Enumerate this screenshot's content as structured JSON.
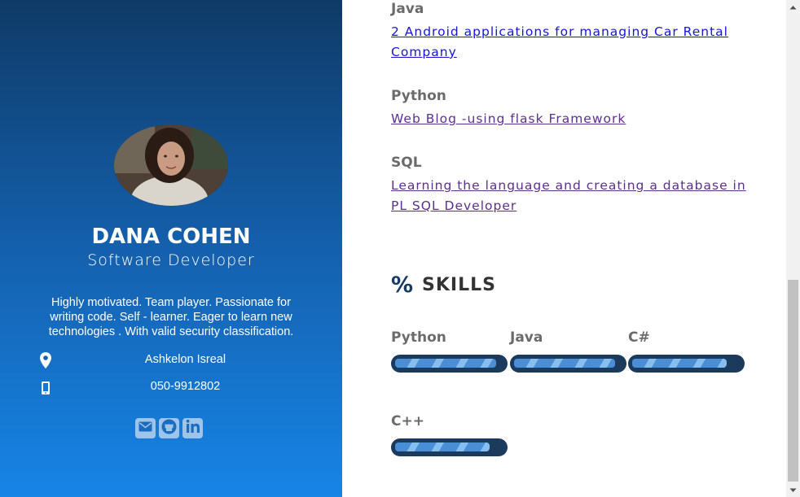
{
  "profile": {
    "name": "DANA COHEN",
    "role": "Software Developer",
    "bio": "Highly motivated. Team player. Passionate for writing code. Self - learner. Eager to learn new technologies . With valid security classification.",
    "location": "Ashkelon Isreal",
    "phone": "050-9912802",
    "socials": [
      {
        "icon": "envelope-icon",
        "label": "email"
      },
      {
        "icon": "github-icon",
        "label": "github"
      },
      {
        "icon": "linkedin-icon",
        "label": "linkedin"
      }
    ]
  },
  "projects": [
    {
      "language": "Java",
      "title": "2 Android applications for managing Car Rental Company",
      "visited": false
    },
    {
      "language": "Python",
      "title": "Web Blog -using flask Framework",
      "visited": true
    },
    {
      "language": "SQL",
      "title": "Learning the language and creating a database in PL SQL Developer",
      "visited": true
    }
  ],
  "skills": {
    "heading_icon": "%",
    "heading": "SKILLS",
    "items": [
      {
        "name": "Python",
        "level": 0.93
      },
      {
        "name": "Java",
        "level": 0.93
      },
      {
        "name": "C#",
        "level": 0.87
      },
      {
        "name": "C++",
        "level": 0.87
      }
    ]
  },
  "colors": {
    "sidebar_top": "#103a66",
    "sidebar_bottom": "#1785e6",
    "bar_track": "#1c3a5c",
    "bar_fill": "#4a8ed6",
    "label_gray": "#6b6b6b",
    "link_visited": "#5c2f8e",
    "link_unvisited": "#1515d6"
  }
}
